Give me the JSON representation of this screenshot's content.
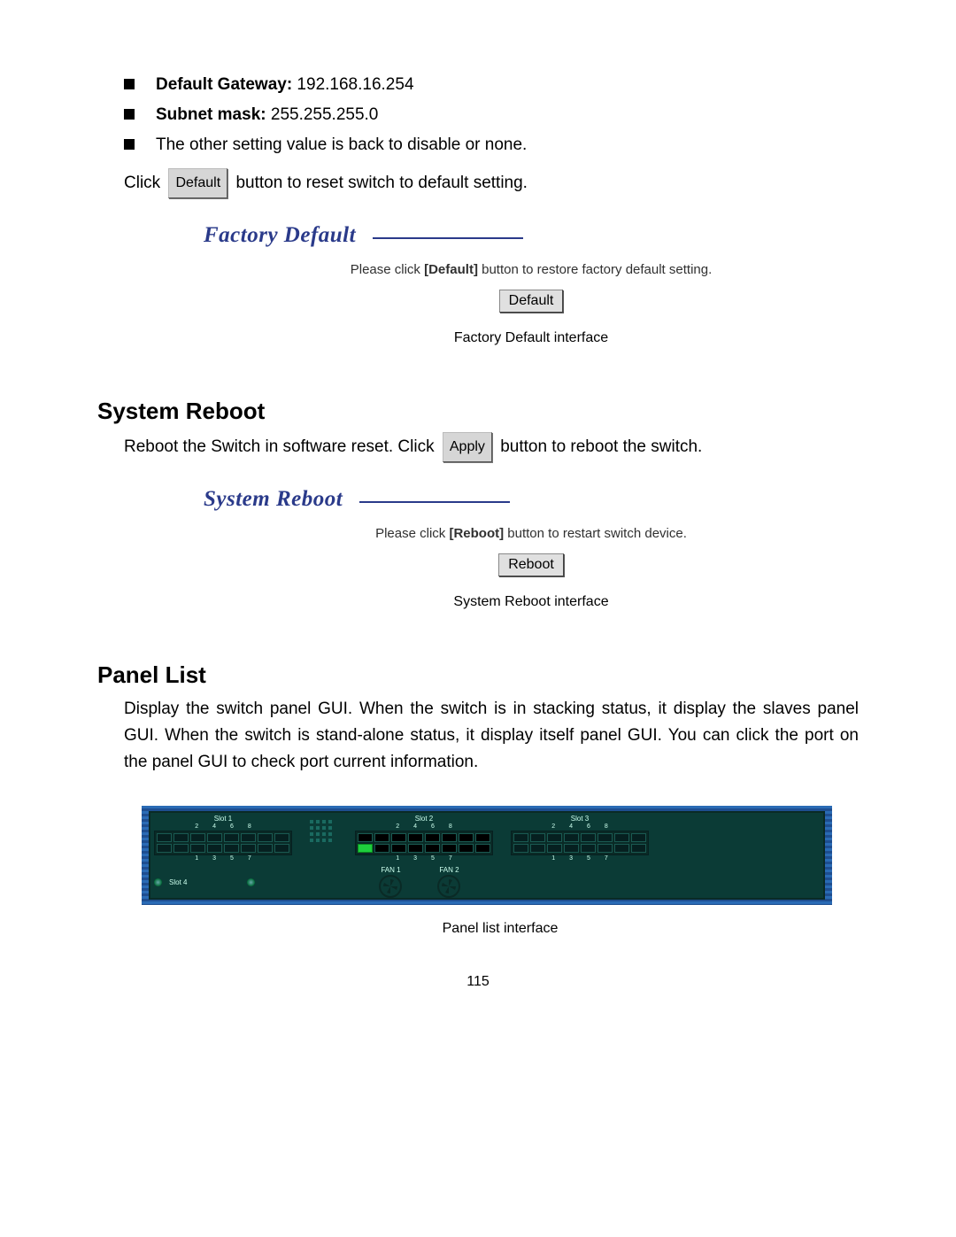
{
  "bullets": {
    "b1_label": "Default Gateway:",
    "b1_value": " 192.168.16.254",
    "b2_label": "Subnet mask:",
    "b2_value": " 255.255.255.0",
    "b3": "The other setting value is back to disable or none."
  },
  "click_line": {
    "pre": "Click ",
    "btn": "Default",
    "post": " button to reset switch to default setting."
  },
  "factory_panel": {
    "title": "Factory Default",
    "desc_pre": "Please click ",
    "desc_bold": "[Default]",
    "desc_post": " button to restore factory default setting.",
    "button": "Default",
    "caption": "Factory Default interface"
  },
  "system_reboot": {
    "heading": "System Reboot",
    "line_pre": "Reboot the Switch in software reset. Click ",
    "inline_btn": "Apply",
    "line_post": " button to reboot the switch.",
    "panel_title": "System Reboot",
    "desc_pre": "Please click ",
    "desc_bold": "[Reboot]",
    "desc_post": " button to restart switch device.",
    "button": "Reboot",
    "caption": "System Reboot interface"
  },
  "panel_list": {
    "heading": "Panel List",
    "para": "Display the switch panel GUI. When the switch is in stacking status, it display the slaves panel GUI. When the switch is stand-alone status, it display itself panel GUI. You can click the port on the panel GUI to check port current information.",
    "caption": "Panel list interface"
  },
  "switch": {
    "slots": [
      "Slot 1",
      "Slot 2",
      "Slot 3",
      "Slot 4"
    ],
    "top_nums": [
      "2",
      "4",
      "6",
      "8"
    ],
    "bot_nums": [
      "1",
      "3",
      "5",
      "7"
    ],
    "fans": [
      "FAN 1",
      "FAN 2"
    ]
  },
  "page_number": "115"
}
